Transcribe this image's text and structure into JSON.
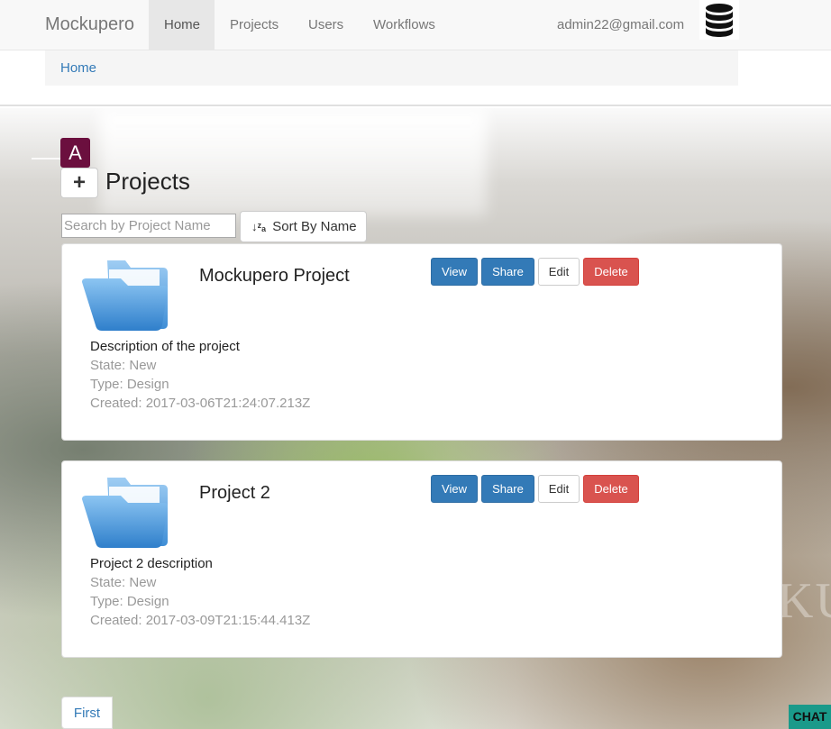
{
  "navbar": {
    "brand": "Mockupero",
    "items": [
      {
        "label": "Home",
        "active": true
      },
      {
        "label": "Projects"
      },
      {
        "label": "Users"
      },
      {
        "label": "Workflows"
      }
    ],
    "user_email": "admin22@gmail.com",
    "db_icon": "database-icon"
  },
  "breadcrumb": {
    "home": "Home"
  },
  "header": {
    "avatar_letter": "A",
    "add_icon": "+",
    "title": "Projects"
  },
  "search": {
    "placeholder": "Search by Project Name",
    "value": ""
  },
  "sort": {
    "label": "Sort By Name",
    "icon": "↓ᶻₐ"
  },
  "projects": [
    {
      "name": "Mockupero Project",
      "description": "Description of the project",
      "state": "State: New",
      "type": "Type: Design",
      "created": "Created: 2017-03-06T21:24:07.213Z",
      "actions": {
        "view": "View",
        "share": "Share",
        "edit": "Edit",
        "delete": "Delete"
      }
    },
    {
      "name": "Project 2",
      "description": "Project 2 description",
      "state": "State: New",
      "type": "Type: Design",
      "created": "Created: 2017-03-09T21:15:44.413Z",
      "actions": {
        "view": "View",
        "share": "Share",
        "edit": "Edit",
        "delete": "Delete"
      }
    }
  ],
  "pagination": {
    "first": "First"
  },
  "chat": {
    "label": "CHAT"
  },
  "watermark": "KU",
  "colors": {
    "primary": "#337ab7",
    "danger": "#d9534f",
    "avatar": "#6b0f3e",
    "chat": "#1a9a8a"
  }
}
